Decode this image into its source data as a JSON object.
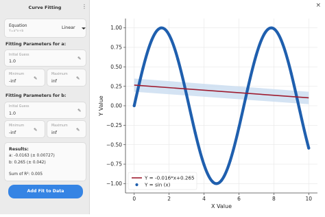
{
  "window": {
    "title": "Curve Fitting",
    "menu_icon": "⋮",
    "close_icon": "×"
  },
  "equation": {
    "label": "Equation",
    "subtitle": "Y=a*x+b",
    "value": "Linear"
  },
  "params_a": {
    "title": "Fitting Parameters for a:",
    "initial_label": "Initial Guess",
    "initial_value": "1.0",
    "min_label": "Minimum",
    "min_value": "-inf",
    "max_label": "Maximum",
    "max_value": "inf"
  },
  "params_b": {
    "title": "Fitting Parameters for b:",
    "initial_label": "Initial Guess",
    "initial_value": "1.0",
    "min_label": "Minimum",
    "min_value": "-inf",
    "max_label": "Maximum",
    "max_value": "inf"
  },
  "results": {
    "title": "Results:",
    "a": "a: -0.0163 (± 0.00727)",
    "b": "b: 0.265 (± 0.042)",
    "sum": "Sum of R²: 0.005"
  },
  "button": {
    "label": "Add Fit to Data"
  },
  "chart_data": {
    "type": "line",
    "xlabel": "X Value",
    "ylabel": "Y Value",
    "xlim": [
      -0.5,
      10.5
    ],
    "ylim": [
      -1.12,
      1.12
    ],
    "xticks": [
      0,
      2,
      4,
      6,
      8,
      10
    ],
    "yticks": [
      -1.0,
      -0.75,
      -0.5,
      -0.25,
      0.0,
      0.25,
      0.5,
      0.75,
      1.0
    ],
    "xtick_labels": [
      "0",
      "2",
      "4",
      "6",
      "8",
      "10"
    ],
    "ytick_labels": [
      "−1.00",
      "−0.75",
      "−0.50",
      "−0.25",
      "0.00",
      "0.25",
      "0.50",
      "0.75",
      "1.00"
    ],
    "grid": true,
    "legend_position": "bottom-left",
    "series": [
      {
        "name": "Y = sin (x)",
        "kind": "scatter",
        "color": "#1f5fae",
        "x": [
          0,
          0.5,
          1,
          1.5,
          2,
          2.5,
          3,
          3.5,
          4,
          4.5,
          5,
          5.5,
          6,
          6.5,
          7,
          7.5,
          8,
          8.5,
          9,
          9.5,
          10
        ],
        "y": [
          0,
          0.479,
          0.841,
          0.997,
          0.909,
          0.598,
          0.141,
          -0.351,
          -0.757,
          -0.978,
          -0.959,
          -0.706,
          -0.279,
          0.215,
          0.657,
          0.938,
          0.989,
          0.798,
          0.412,
          -0.075,
          -0.544
        ]
      },
      {
        "name": "Y = -0.016*x+0.265",
        "kind": "line",
        "color": "#9e1b2f",
        "x": [
          0,
          10
        ],
        "y": [
          0.265,
          0.102
        ],
        "band_color": "#c6d9ef",
        "band_upper": [
          0.35,
          0.18
        ],
        "band_lower": [
          0.18,
          0.02
        ]
      }
    ]
  }
}
